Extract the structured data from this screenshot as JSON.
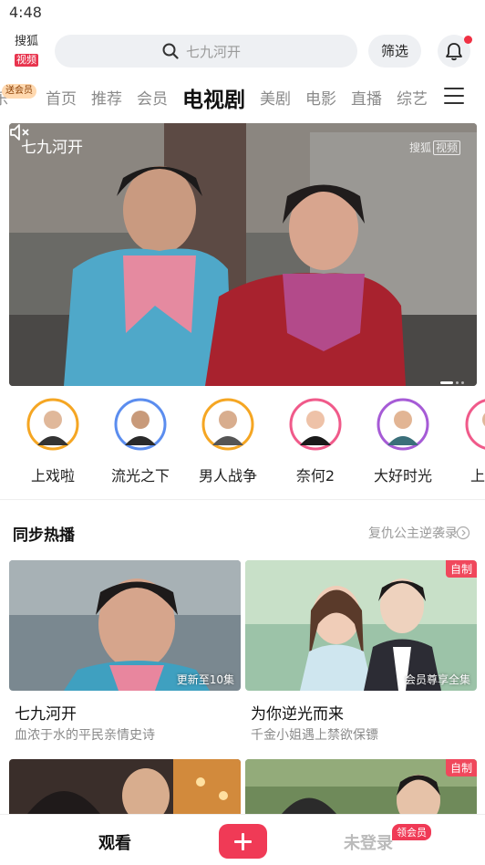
{
  "status": {
    "time": "4:48"
  },
  "header": {
    "logo_top": "搜狐",
    "logo_bottom": "视频",
    "search_placeholder": "七九河开",
    "filter_label": "筛选"
  },
  "channels": {
    "promo_badge": "送会员",
    "partial_tab": "乐",
    "tabs": [
      "首页",
      "推荐",
      "会员",
      "电视剧",
      "美剧",
      "电影",
      "直播",
      "综艺"
    ],
    "active_index": 3
  },
  "banner": {
    "title": "七九河开",
    "watermark_text": "搜狐",
    "watermark_box": "视频"
  },
  "stars": [
    {
      "name": "上戏啦",
      "ring": "#f5a623"
    },
    {
      "name": "流光之下",
      "ring": "#5b8def"
    },
    {
      "name": "男人战争",
      "ring": "#f5a623"
    },
    {
      "name": "奈何2",
      "ring": "#f05a8a"
    },
    {
      "name": "大好时光",
      "ring": "#a65bd6"
    },
    {
      "name": "上",
      "ring": "#f05a8a"
    }
  ],
  "section": {
    "title": "同步热播",
    "link": "复仇公主逆袭录"
  },
  "cards": [
    {
      "title": "七九河开",
      "subtitle": "血浓于水的平民亲情史诗",
      "meta": "更新至10集",
      "badge": ""
    },
    {
      "title": "为你逆光而来",
      "subtitle": "千金小姐遇上禁欲保镖",
      "meta": "会员尊享全集",
      "badge": "自制"
    }
  ],
  "cards_row2": [
    {
      "badge": ""
    },
    {
      "badge": "自制"
    }
  ],
  "bottom_nav": {
    "watch": "观看",
    "login": "未登录",
    "vip_badge": "领会员"
  },
  "colors": {
    "brand": "#f03a56",
    "badge": "#f0485c"
  }
}
